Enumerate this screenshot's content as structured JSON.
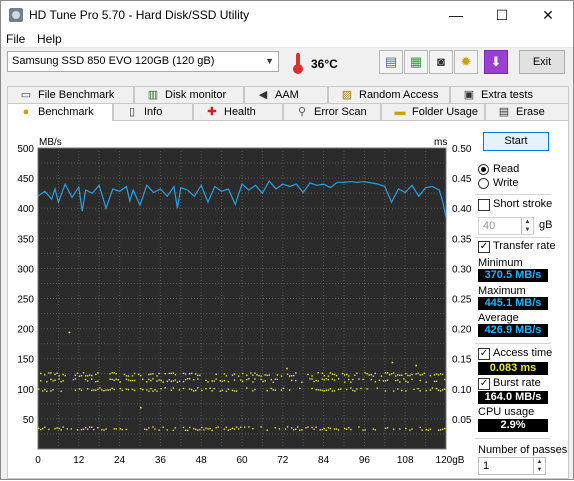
{
  "window": {
    "title": "HD Tune Pro 5.70 - Hard Disk/SSD Utility",
    "minimize": "—",
    "maximize": "☐",
    "close": "✕"
  },
  "menu": {
    "file": "File",
    "help": "Help"
  },
  "toolbar": {
    "drive": "Samsung SSD 850 EVO 120GB (120 gB)",
    "temperature": "36°C",
    "exit": "Exit",
    "icons": [
      "copy-info-icon",
      "copy-screen-icon",
      "screenshot-camera-icon",
      "options-icon",
      "save-down-icon"
    ]
  },
  "tabs_top": [
    {
      "label": "File Benchmark",
      "icon": "file-benchmark-icon"
    },
    {
      "label": "Disk monitor",
      "icon": "disk-monitor-icon"
    },
    {
      "label": "AAM",
      "icon": "speaker-icon"
    },
    {
      "label": "Random Access",
      "icon": "random-access-icon"
    },
    {
      "label": "Extra tests",
      "icon": "extra-tests-icon"
    }
  ],
  "tabs_bottom": [
    {
      "label": "Benchmark",
      "icon": "benchmark-icon",
      "active": true
    },
    {
      "label": "Info",
      "icon": "info-icon"
    },
    {
      "label": "Health",
      "icon": "health-cross-icon"
    },
    {
      "label": "Error Scan",
      "icon": "magnifier-icon"
    },
    {
      "label": "Folder Usage",
      "icon": "folder-icon"
    },
    {
      "label": "Erase",
      "icon": "erase-icon"
    }
  ],
  "controls": {
    "start": "Start",
    "read": "Read",
    "write": "Write",
    "mode": "read",
    "short_stroke": "Short stroke",
    "short_stroke_checked": false,
    "short_stroke_value": "40",
    "short_stroke_unit": "gB",
    "transfer_rate": "Transfer rate",
    "transfer_rate_checked": true,
    "minimum_label": "Minimum",
    "minimum_value": "370.5 MB/s",
    "maximum_label": "Maximum",
    "maximum_value": "445.1 MB/s",
    "average_label": "Average",
    "average_value": "426.9 MB/s",
    "access_time": "Access time",
    "access_time_checked": true,
    "access_time_value": "0.083 ms",
    "burst_rate": "Burst rate",
    "burst_rate_checked": true,
    "burst_rate_value": "164.0 MB/s",
    "cpu_usage": "CPU usage",
    "cpu_usage_value": "2.9%",
    "passes_label": "Number of passes",
    "passes_value": "1"
  },
  "chart_data": {
    "type": "line",
    "left_unit": "MB/s",
    "right_unit": "ms",
    "y_left_ticks": [
      "500",
      "450",
      "400",
      "350",
      "300",
      "250",
      "200",
      "150",
      "100",
      "50"
    ],
    "y_right_ticks": [
      "0.50",
      "0.45",
      "0.40",
      "0.35",
      "0.30",
      "0.25",
      "0.20",
      "0.15",
      "0.10",
      "0.05"
    ],
    "x_ticks": [
      "0",
      "12",
      "24",
      "36",
      "48",
      "60",
      "72",
      "84",
      "96",
      "108",
      "120gB"
    ],
    "xlim": [
      0,
      120
    ],
    "ylim_left": [
      0,
      500
    ],
    "ylim_right": [
      0,
      0.5
    ],
    "grid": true,
    "colors": {
      "background": "#2b2b2b",
      "grid": "#595959",
      "transfer": "#2aa0e0",
      "access": "#e6e640"
    },
    "transfer_rate": {
      "x": [
        0,
        2,
        4,
        5,
        6,
        8,
        10,
        12,
        13,
        14,
        16,
        18,
        20,
        22,
        24,
        26,
        27,
        28,
        30,
        32,
        34,
        36,
        38,
        40,
        41,
        42,
        44,
        46,
        48,
        50,
        52,
        54,
        56,
        58,
        60,
        62,
        64,
        66,
        68,
        70,
        72,
        74,
        76,
        78,
        80,
        82,
        84,
        86,
        88,
        90,
        92,
        94,
        96,
        98,
        100,
        102,
        104,
        106,
        108,
        110,
        112,
        114,
        116,
        118,
        119,
        120
      ],
      "values": [
        420,
        428,
        415,
        432,
        410,
        440,
        418,
        435,
        395,
        430,
        425,
        438,
        400,
        432,
        428,
        436,
        412,
        430,
        405,
        438,
        426,
        432,
        420,
        436,
        400,
        434,
        430,
        420,
        438,
        410,
        436,
        428,
        432,
        406,
        440,
        430,
        438,
        425,
        445,
        432,
        440,
        436,
        440,
        426,
        442,
        438,
        440,
        434,
        443,
        443,
        444,
        443,
        444,
        442,
        440,
        436,
        410,
        432,
        426,
        438,
        420,
        434,
        436,
        430,
        412,
        385
      ]
    },
    "access_time": {
      "bands_ms": [
        0.035,
        0.1,
        0.115,
        0.125
      ],
      "outliers": [
        {
          "x": 9,
          "ms": 0.195
        },
        {
          "x": 30,
          "ms": 0.07
        },
        {
          "x": 73,
          "ms": 0.135
        },
        {
          "x": 104,
          "ms": 0.145
        },
        {
          "x": 111,
          "ms": 0.14
        }
      ]
    }
  }
}
